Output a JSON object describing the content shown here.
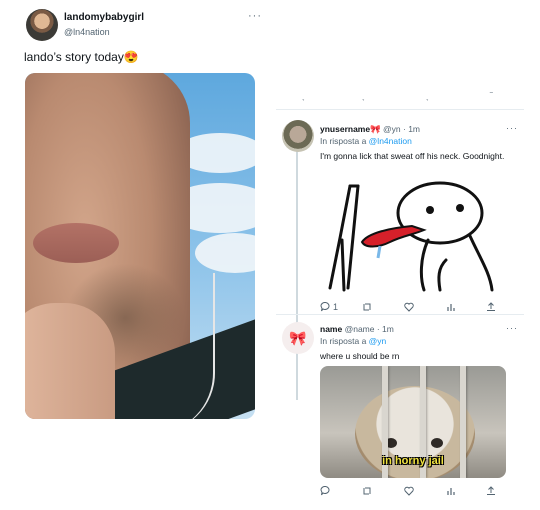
{
  "left_tweet": {
    "display_name": "landomybabygirl",
    "handle": "@ln4nation",
    "more": "···",
    "text": "lando’s story today😍"
  },
  "right_thread": {
    "replies": [
      {
        "name": "ynusername🎀",
        "handle": "@yn · 1m",
        "in_reply_prefix": "In risposta a ",
        "in_reply_to": "@ln4nation",
        "text": "I'm gonna lick that sweat off his neck. Goodnight.",
        "more": "···",
        "reply_count": "1",
        "avatar_icon": "profile-photo"
      },
      {
        "name": "name",
        "handle": "@name · 1m",
        "in_reply_prefix": "In risposta a ",
        "in_reply_to": "@yn",
        "text": "where u should be rn",
        "more": "···",
        "media_caption": "in horny jail",
        "avatar_icon": "bow-icon"
      }
    ]
  },
  "colors": {
    "accent": "#1d9bf0",
    "muted": "#536471",
    "caption_yellow": "#f1e340"
  }
}
